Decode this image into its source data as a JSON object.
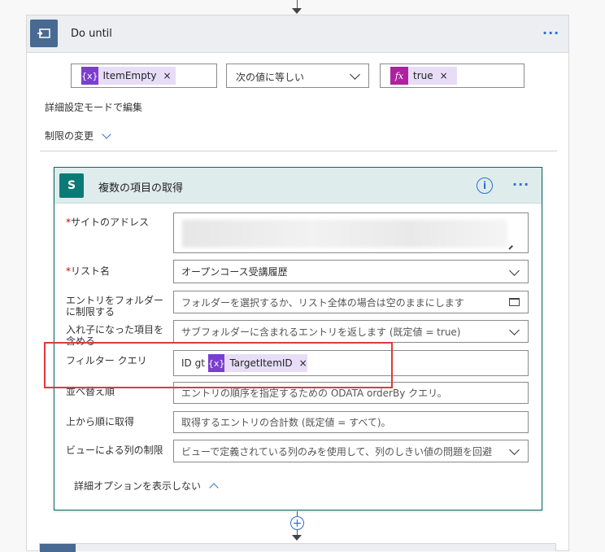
{
  "do_until": {
    "title": "Do until",
    "condition": {
      "left_token": "ItemEmpty",
      "left_token_icon": "{x}",
      "operator": "次の値に等しい",
      "right_token": "true",
      "right_token_icon": "fx"
    },
    "advanced_mode": "詳細設定モードで編集",
    "change_limits": "制限の変更"
  },
  "action": {
    "title": "複数の項目の取得",
    "icon_letter": "S",
    "info_glyph": "i",
    "fields": {
      "site_label": "サイトのアドレス",
      "list_label": "リスト名",
      "list_value": "オープンコース受講履歴",
      "folder_label": "エントリをフォルダーに制限する",
      "folder_placeholder": "フォルダーを選択するか、リスト全体の場合は空のままにします",
      "nested_label": "入れ子になった項目を含める",
      "nested_placeholder": "サブフォルダーに含まれるエントリを返します (既定値 = true)",
      "filter_label": "フィルター クエリ",
      "filter_prefix": "ID gt",
      "filter_token": "TargetItemID",
      "filter_token_icon": "{x}",
      "order_label": "並べ替え順",
      "order_placeholder": "エントリの順序を指定するための ODATA orderBy クエリ。",
      "top_label": "上から順に取得",
      "top_placeholder": "取得するエントリの合計数 (既定値 = すべて)。",
      "view_label": "ビューによる列の制限",
      "view_placeholder": "ビューで定義されている列のみを使用して、列のしきい値の問題を回避"
    },
    "hide_advanced": "詳細オプションを表示しない"
  },
  "asterisk": "*",
  "remove_glyph": "×",
  "more_glyph": "···",
  "colors": {
    "accent": "#2f6fd0",
    "token_violet": "#7b3fcf",
    "token_magenta": "#ac22a0",
    "sharepoint": "#0b7a75",
    "highlight": "#e0393b"
  }
}
